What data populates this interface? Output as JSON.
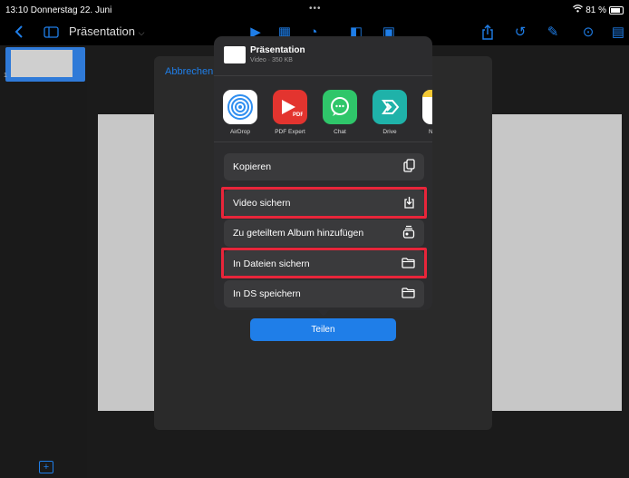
{
  "status": {
    "time_date": "13:10  Donnerstag 22. Juni",
    "battery": "81 %"
  },
  "toolbar": {
    "title": "Präsentation"
  },
  "slides": {
    "number": "1"
  },
  "dialog": {
    "cancel": "Abbrechen",
    "share": "Teilen"
  },
  "share_sheet": {
    "file_name": "Präsentation",
    "file_meta": "Video · 350 KB",
    "apps": [
      {
        "label": "AirDrop",
        "icon": "airdrop-icon",
        "color": "#2f8ef0"
      },
      {
        "label": "PDF Expert",
        "icon": "pdf-expert-icon",
        "color": "#e3342f"
      },
      {
        "label": "Chat",
        "icon": "chat-icon",
        "color": "#2fc66a"
      },
      {
        "label": "Drive",
        "icon": "drive-icon",
        "color": "#1fb2a9"
      },
      {
        "label": "N",
        "icon": "notes-icon",
        "color": "#f3c833"
      }
    ],
    "actions": [
      {
        "label": "Kopieren",
        "icon": "copy-icon"
      },
      {
        "label": "Video sichern",
        "icon": "save-video-icon"
      },
      {
        "label": "Zu geteiltem Album hinzufügen",
        "icon": "shared-album-icon"
      },
      {
        "label": "In Dateien sichern",
        "icon": "folder-icon"
      },
      {
        "label": "In DS speichern",
        "icon": "folder-icon"
      }
    ]
  },
  "colors": {
    "accent": "#1f7ee8",
    "highlight": "#e8253a"
  }
}
